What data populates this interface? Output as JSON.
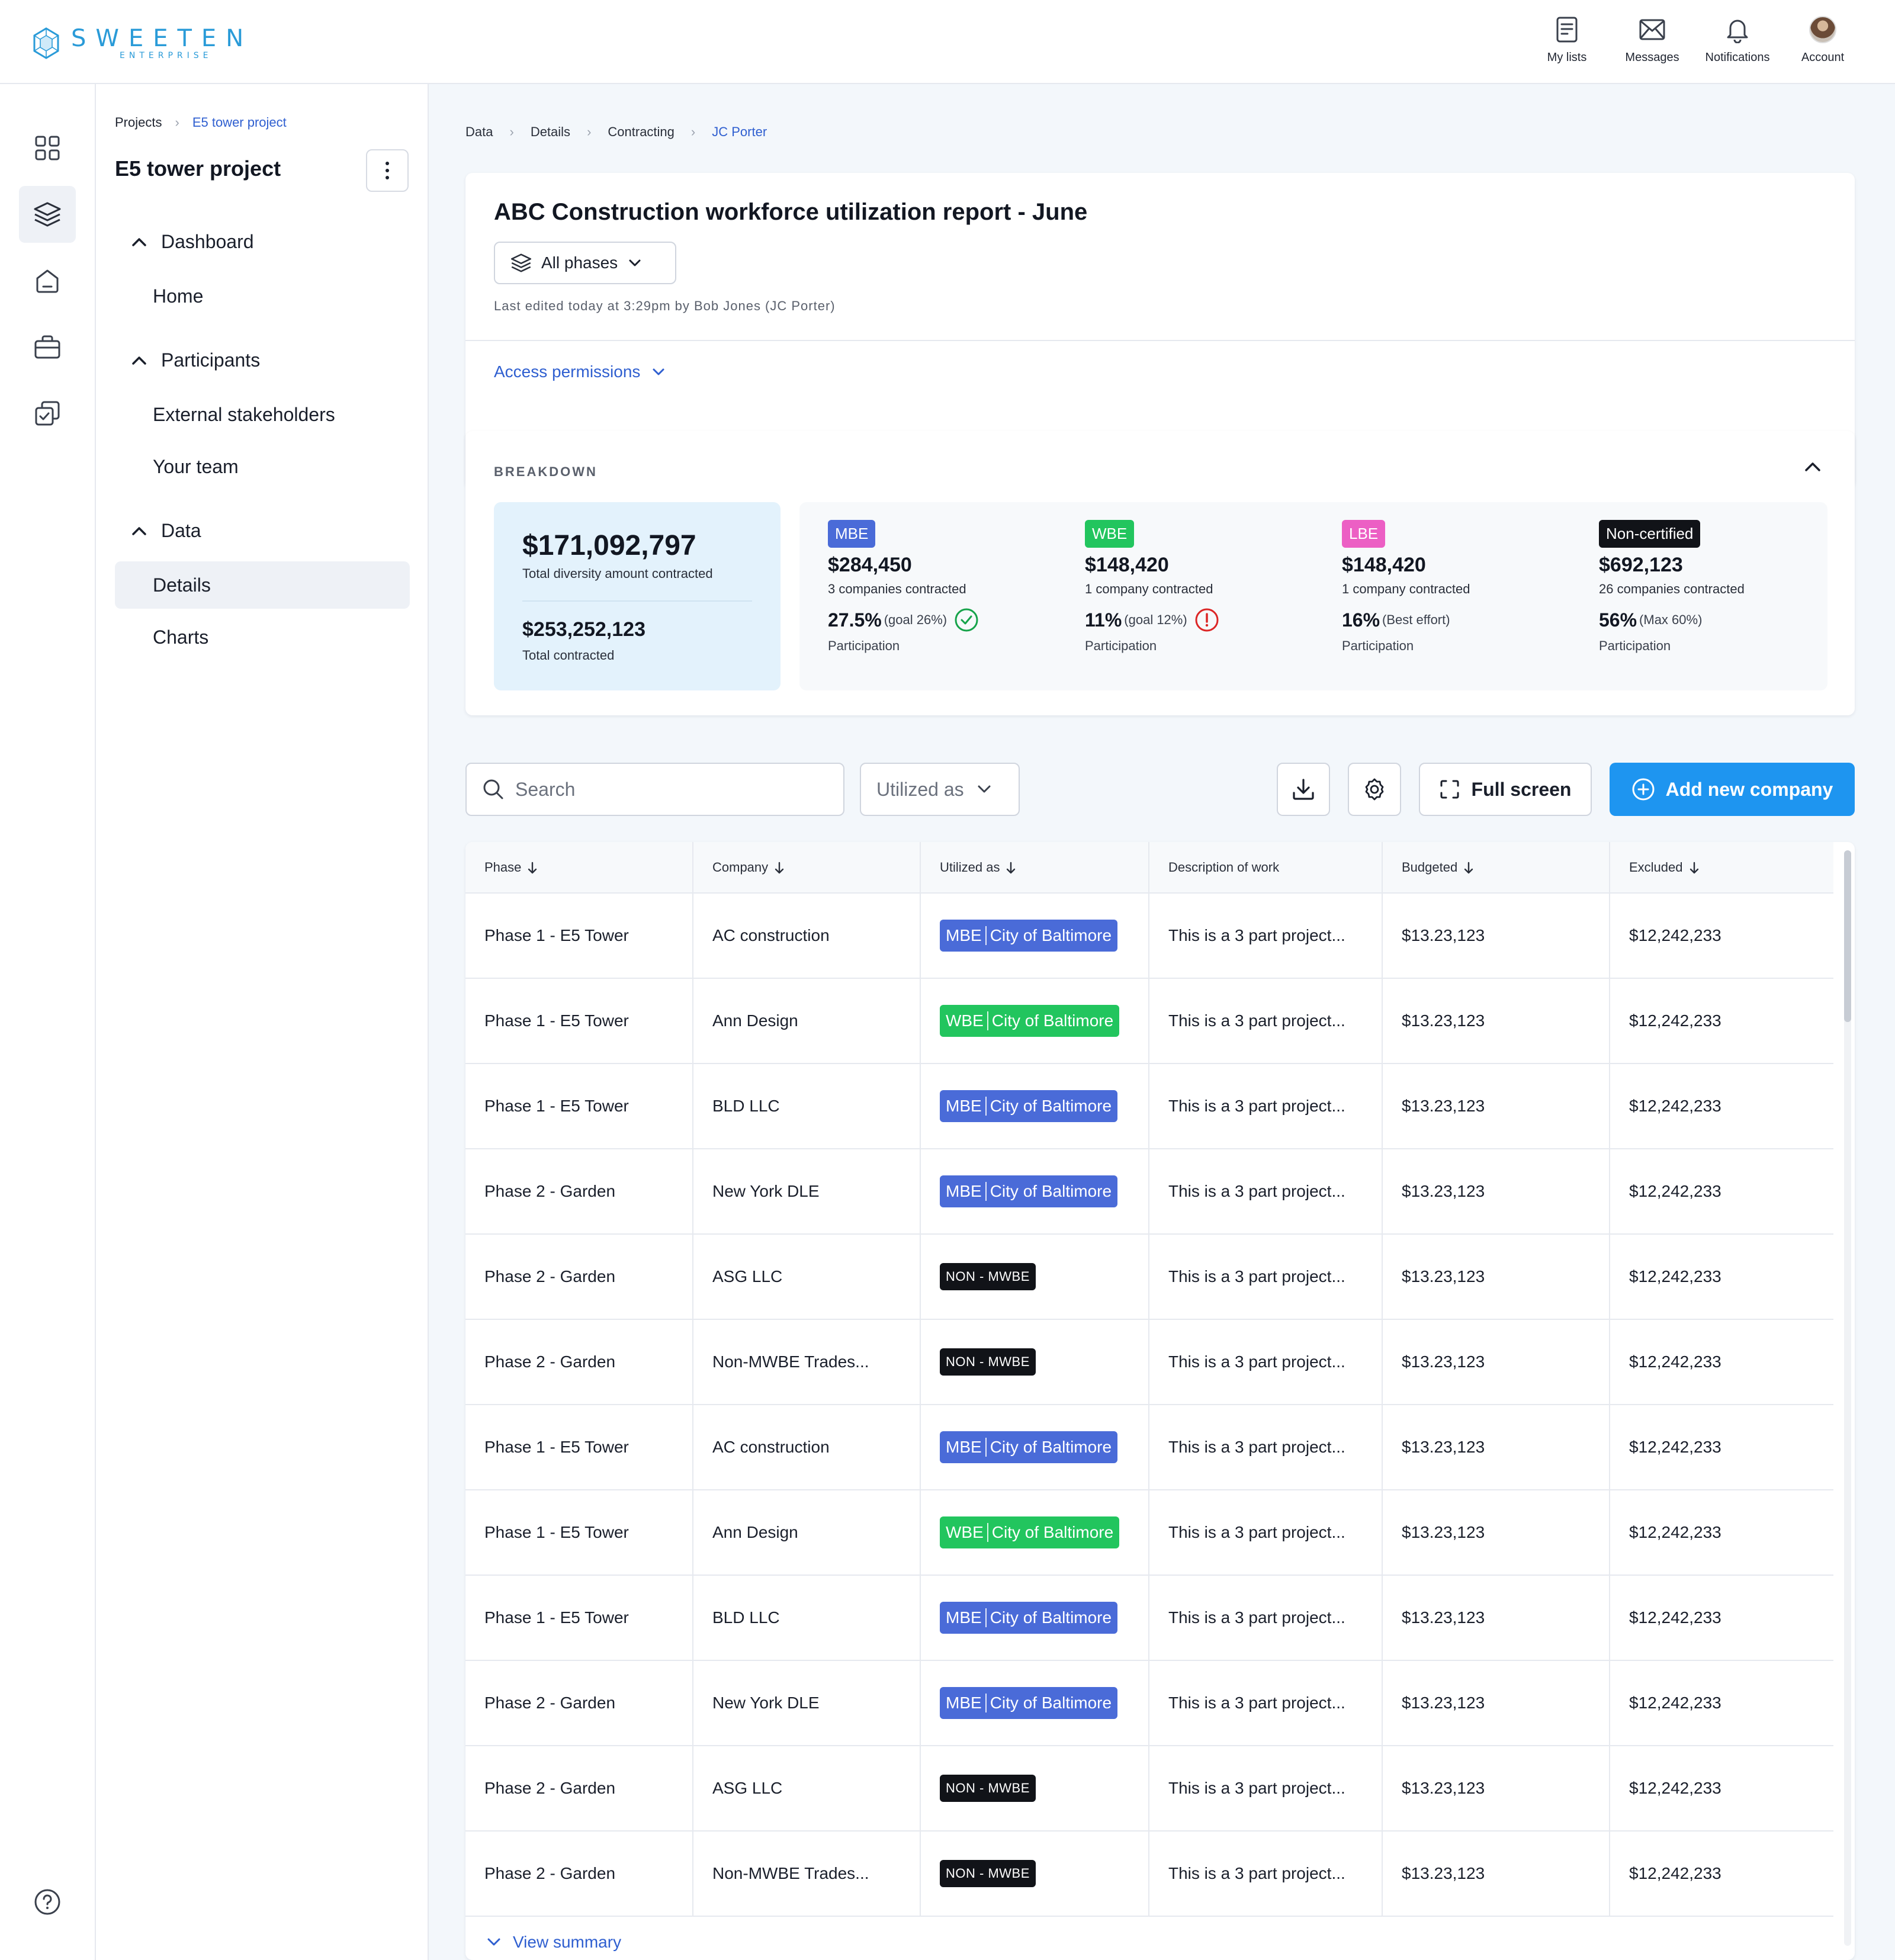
{
  "brand": {
    "word": "SWEETEN",
    "sub": "ENTERPRISE"
  },
  "header": {
    "actions": [
      {
        "label": "My lists",
        "icon": "list-icon"
      },
      {
        "label": "Messages",
        "icon": "envelope-icon"
      },
      {
        "label": "Notifications",
        "icon": "bell-icon"
      },
      {
        "label": "Account",
        "icon": "avatar"
      }
    ]
  },
  "project_nav": {
    "breadcrumb": [
      "Projects",
      "E5 tower project"
    ],
    "title": "E5 tower project",
    "groups": [
      {
        "label": "Dashboard",
        "items": [
          "Home"
        ]
      },
      {
        "label": "Participants",
        "items": [
          "External stakeholders",
          "Your team"
        ]
      },
      {
        "label": "Data",
        "items": [
          "Details",
          "Charts"
        ]
      }
    ],
    "active_item": "Details"
  },
  "main": {
    "breadcrumb": [
      "Data",
      "Details",
      "Contracting",
      "JC Porter"
    ],
    "report": {
      "title": "ABC Construction workforce utilization report - June",
      "phase_selector": "All phases",
      "last_edited": "Last edited today at 3:29pm by Bob Jones (JC Porter)",
      "access_permissions": "Access permissions"
    },
    "breakdown": {
      "label": "BREAKDOWN",
      "total_diversity": "$171,092,797",
      "total_diversity_label": "Total diversity amount contracted",
      "total_contracted": "$253,252,123",
      "total_contracted_label": "Total contracted",
      "categories": [
        {
          "badge": "MBE",
          "color": "#4a6bd8",
          "amount": "$284,450",
          "count": "3 companies contracted",
          "pct": "27.5%",
          "goal": "(goal 26%)",
          "status": "met",
          "participation": "Participation"
        },
        {
          "badge": "WBE",
          "color": "#22c55e",
          "amount": "$148,420",
          "count": "1 company contracted",
          "pct": "11%",
          "goal": "(goal 12%)",
          "status": "warning",
          "participation": "Participation"
        },
        {
          "badge": "LBE",
          "color": "#ec5fc4",
          "amount": "$148,420",
          "count": "1 company contracted",
          "pct": "16%",
          "goal": "(Best effort)",
          "status": "none",
          "participation": "Participation"
        },
        {
          "badge": "Non-certified",
          "color": "#111318",
          "amount": "$692,123",
          "count": "26 companies contracted",
          "pct": "56%",
          "goal": "(Max 60%)",
          "status": "none",
          "participation": "Participation"
        }
      ]
    },
    "toolbar": {
      "search_placeholder": "Search",
      "filter_label": "Utilized as",
      "full_screen": "Full screen",
      "add_company": "Add new company"
    },
    "table": {
      "columns": [
        {
          "label": "Phase",
          "sortable": true
        },
        {
          "label": "Company",
          "sortable": true
        },
        {
          "label": "Utilized as",
          "sortable": true
        },
        {
          "label": "Description of work",
          "sortable": false
        },
        {
          "label": "Budgeted",
          "sortable": true
        },
        {
          "label": "Excluded",
          "sortable": true
        }
      ],
      "rows": [
        {
          "phase": "Phase 1 - E5 Tower",
          "company": "AC construction",
          "type": "mbe",
          "cert": "MBE",
          "agency": "City of Baltimore",
          "desc": "This is a 3 part project...",
          "budgeted": "$13.23,123",
          "excluded": "$12,242,233"
        },
        {
          "phase": "Phase 1 - E5 Tower",
          "company": "Ann Design",
          "type": "wbe",
          "cert": "WBE",
          "agency": "City of Baltimore",
          "desc": "This is a 3 part project...",
          "budgeted": "$13.23,123",
          "excluded": "$12,242,233"
        },
        {
          "phase": "Phase 1 - E5 Tower",
          "company": "BLD LLC",
          "type": "mbe",
          "cert": "MBE",
          "agency": "City of Baltimore",
          "desc": "This is a 3 part project...",
          "budgeted": "$13.23,123",
          "excluded": "$12,242,233"
        },
        {
          "phase": "Phase 2 - Garden",
          "company": "New York DLE",
          "type": "mbe",
          "cert": "MBE",
          "agency": "City of Baltimore",
          "desc": "This is a 3 part project...",
          "budgeted": "$13.23,123",
          "excluded": "$12,242,233"
        },
        {
          "phase": "Phase 2 - Garden",
          "company": "ASG LLC",
          "type": "non",
          "cert": "NON - MWBE",
          "agency": "",
          "desc": "This is a 3 part project...",
          "budgeted": "$13.23,123",
          "excluded": "$12,242,233"
        },
        {
          "phase": "Phase 2 - Garden",
          "company": "Non-MWBE Trades...",
          "type": "non",
          "cert": "NON - MWBE",
          "agency": "",
          "desc": "This is a 3 part project...",
          "budgeted": "$13.23,123",
          "excluded": "$12,242,233"
        },
        {
          "phase": "Phase 1 - E5 Tower",
          "company": "AC construction",
          "type": "mbe",
          "cert": "MBE",
          "agency": "City of Baltimore",
          "desc": "This is a 3 part project...",
          "budgeted": "$13.23,123",
          "excluded": "$12,242,233"
        },
        {
          "phase": "Phase 1 - E5 Tower",
          "company": "Ann Design",
          "type": "wbe",
          "cert": "WBE",
          "agency": "City of Baltimore",
          "desc": "This is a 3 part project...",
          "budgeted": "$13.23,123",
          "excluded": "$12,242,233"
        },
        {
          "phase": "Phase 1 - E5 Tower",
          "company": "BLD LLC",
          "type": "mbe",
          "cert": "MBE",
          "agency": "City of Baltimore",
          "desc": "This is a 3 part project...",
          "budgeted": "$13.23,123",
          "excluded": "$12,242,233"
        },
        {
          "phase": "Phase 2 - Garden",
          "company": "New York DLE",
          "type": "mbe",
          "cert": "MBE",
          "agency": "City of Baltimore",
          "desc": "This is a 3 part project...",
          "budgeted": "$13.23,123",
          "excluded": "$12,242,233"
        },
        {
          "phase": "Phase 2 - Garden",
          "company": "ASG LLC",
          "type": "non",
          "cert": "NON - MWBE",
          "agency": "",
          "desc": "This is a 3 part project...",
          "budgeted": "$13.23,123",
          "excluded": "$12,242,233"
        },
        {
          "phase": "Phase 2 - Garden",
          "company": "Non-MWBE Trades...",
          "type": "non",
          "cert": "NON - MWBE",
          "agency": "",
          "desc": "This is a 3 part project...",
          "budgeted": "$13.23,123",
          "excluded": "$12,242,233"
        }
      ],
      "view_summary": "View summary"
    }
  }
}
